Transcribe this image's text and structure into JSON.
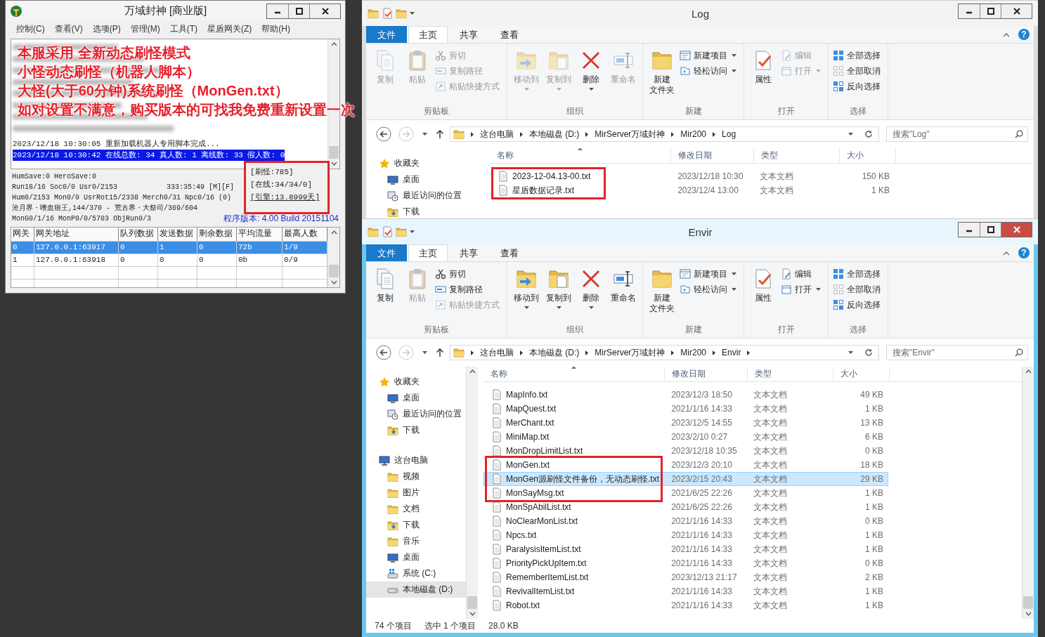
{
  "server_window": {
    "title": "万域封神 [商业版]",
    "menu": [
      "控制(C)",
      "查看(V)",
      "选项(P)",
      "管理(M)",
      "工具(T)",
      "星盾网关(Z)",
      "帮助(H)"
    ],
    "annotation_lines": [
      "本服采用 全新动态刷怪模式",
      "小怪动态刷怪（机器人脚本）",
      "大怪(大于60分钟)系统刷怪（MonGen.txt）",
      "如对设置不满意，购买版本的可找我免费重新设置一次"
    ],
    "log_lines": [
      {
        "text": "2023/12/18 10:30:05 重新加载机器人专用脚本完成...",
        "selected": false
      },
      {
        "text": "2023/12/18 10:30:42 在线总数: 34 真人数: 1 离线数: 33 假人数: 0",
        "selected": true
      }
    ],
    "status_lines": [
      {
        "text": "HumSave:0 HeroSave:0"
      },
      {
        "text": "Run18/16 Soc0/0 Usr0/2153",
        "aside": {
          "text": "333:35:49 [M][F]",
          "kind": "time"
        }
      },
      {
        "text": "Hum0/2153 Mon0/0 UsrRot15/2338 Merch0/31 Npc0/16 (0)"
      },
      {
        "text": "沧月界・嗜血狼王,144/370 - 荒古界・大祭司/369/604"
      },
      {
        "text": "MonG0/1/16 MonP0/0/5703 ObjRun0/3",
        "aside": {
          "text": "程序版本: 4.00 Build 20151104",
          "kind": "version"
        }
      }
    ],
    "stats_box": {
      "circled": true,
      "lines": [
        {
          "text": "[刷怪:785]",
          "underlined": false
        },
        {
          "text": "[在线:34/34/0]",
          "underlined": false
        },
        {
          "text": "[引擎:13.8999天]",
          "underlined": true
        }
      ]
    },
    "gateway_table": {
      "columns": [
        "网关",
        "网关地址",
        "队列数据",
        "发送数据",
        "剩余数据",
        "平均流量",
        "最高人数"
      ],
      "rows": [
        {
          "cells": [
            "0",
            "127.0.0.1:63917",
            "0",
            "1",
            "0",
            "72b",
            "1/9"
          ],
          "selected": true
        },
        {
          "cells": [
            "1",
            "127.0.0.1:63918",
            "0",
            "0",
            "0",
            "0b",
            "0/9"
          ],
          "selected": false
        }
      ]
    }
  },
  "explorers": [
    {
      "title": "Log",
      "active": false,
      "scrollbars": false,
      "help": "?",
      "tabs": [
        {
          "label": "文件",
          "kind": "file",
          "selected": false
        },
        {
          "label": "主页",
          "kind": "tab",
          "selected": true
        },
        {
          "label": "共享",
          "kind": "tab",
          "selected": false
        },
        {
          "label": "查看",
          "kind": "tab",
          "selected": false
        }
      ],
      "ribbon": [
        {
          "label": "剪贴板",
          "items": [
            {
              "label": "复制",
              "kind": "large",
              "disabled": true,
              "dropdown": false
            },
            {
              "label": "粘贴",
              "kind": "large",
              "disabled": true,
              "dropdown": false
            },
            {
              "label": "剪切",
              "kind": "small",
              "disabled": true,
              "dropdown": false
            },
            {
              "label": "复制路径",
              "kind": "small",
              "disabled": true,
              "dropdown": false
            },
            {
              "label": "粘贴快捷方式",
              "kind": "small",
              "disabled": true,
              "dropdown": false
            }
          ]
        },
        {
          "label": "组织",
          "items": [
            {
              "label": "移动到",
              "kind": "large",
              "disabled": true,
              "dropdown": true
            },
            {
              "label": "复制到",
              "kind": "large",
              "disabled": true,
              "dropdown": true
            },
            {
              "label": "删除",
              "kind": "large",
              "disabled": false,
              "dropdown": true
            },
            {
              "label": "重命名",
              "kind": "large",
              "disabled": true,
              "dropdown": false
            }
          ]
        },
        {
          "label": "新建",
          "items": [
            {
              "label_lines": [
                "新建",
                "文件夹"
              ],
              "kind": "large",
              "disabled": false,
              "dropdown": false
            },
            {
              "label": "新建项目",
              "kind": "small",
              "disabled": false,
              "dropdown": true
            },
            {
              "label": "轻松访问",
              "kind": "small",
              "disabled": false,
              "dropdown": true
            }
          ]
        },
        {
          "label": "打开",
          "items": [
            {
              "label": "属性",
              "kind": "large",
              "disabled": false,
              "dropdown": false
            },
            {
              "label": "编辑",
              "kind": "small",
              "disabled": true,
              "dropdown": false
            },
            {
              "label": "打开",
              "kind": "small",
              "disabled": true,
              "dropdown": true
            }
          ]
        },
        {
          "label": "选择",
          "items": [
            {
              "label": "全部选择",
              "kind": "small",
              "disabled": false,
              "dropdown": false
            },
            {
              "label": "全部取消",
              "kind": "small",
              "disabled": false,
              "dropdown": false
            },
            {
              "label": "反向选择",
              "kind": "small",
              "disabled": false,
              "dropdown": false
            }
          ]
        }
      ],
      "breadcrumb": [
        "这台电脑",
        "本地磁盘 (D:)",
        "MirServer万域封神",
        "Mir200",
        "Log"
      ],
      "breadcrumb_open_end": false,
      "search_placeholder": "搜索\"Log\"",
      "sidebar": [
        {
          "label": "收藏夹",
          "kind": "favorites",
          "selected": false,
          "children": [
            {
              "label": "桌面",
              "kind": "desktop",
              "selected": false
            },
            {
              "label": "最近访问的位置",
              "kind": "places",
              "selected": false
            },
            {
              "label": "下载",
              "kind": "downloads",
              "selected": false
            }
          ]
        }
      ],
      "columns": [
        {
          "label": "名称",
          "sorted": true
        },
        {
          "label": "修改日期",
          "sorted": false
        },
        {
          "label": "类型",
          "sorted": false
        },
        {
          "label": "大小",
          "sorted": false
        }
      ],
      "files": [
        {
          "name": "2023-12-04.13-00.txt",
          "date": "2023/12/18 10:30",
          "type": "文本文档",
          "size": "150 KB",
          "selected": false,
          "circled": true
        },
        {
          "name": "星盾数据记录.txt",
          "date": "2023/12/4 13:00",
          "type": "文本文档",
          "size": "1 KB",
          "selected": false,
          "circled": true
        }
      ]
    },
    {
      "title": "Envir",
      "active": true,
      "scrollbars": true,
      "help": "?",
      "tabs": [
        {
          "label": "文件",
          "kind": "file",
          "selected": false
        },
        {
          "label": "主页",
          "kind": "tab",
          "selected": true
        },
        {
          "label": "共享",
          "kind": "tab",
          "selected": false
        },
        {
          "label": "查看",
          "kind": "tab",
          "selected": false
        }
      ],
      "ribbon": [
        {
          "label": "剪贴板",
          "items": [
            {
              "label": "复制",
              "kind": "large",
              "disabled": false,
              "dropdown": false
            },
            {
              "label": "粘贴",
              "kind": "large",
              "disabled": true,
              "dropdown": false
            },
            {
              "label": "剪切",
              "kind": "small",
              "disabled": false,
              "dropdown": false
            },
            {
              "label": "复制路径",
              "kind": "small",
              "disabled": false,
              "dropdown": false
            },
            {
              "label": "粘贴快捷方式",
              "kind": "small",
              "disabled": true,
              "dropdown": false
            }
          ]
        },
        {
          "label": "组织",
          "items": [
            {
              "label": "移动到",
              "kind": "large",
              "disabled": false,
              "dropdown": true
            },
            {
              "label": "复制到",
              "kind": "large",
              "disabled": false,
              "dropdown": true
            },
            {
              "label": "删除",
              "kind": "large",
              "disabled": false,
              "dropdown": true
            },
            {
              "label": "重命名",
              "kind": "large",
              "disabled": false,
              "dropdown": false
            }
          ]
        },
        {
          "label": "新建",
          "items": [
            {
              "label_lines": [
                "新建",
                "文件夹"
              ],
              "kind": "large",
              "disabled": false,
              "dropdown": false
            },
            {
              "label": "新建项目",
              "kind": "small",
              "disabled": false,
              "dropdown": true
            },
            {
              "label": "轻松访问",
              "kind": "small",
              "disabled": false,
              "dropdown": true
            }
          ]
        },
        {
          "label": "打开",
          "items": [
            {
              "label": "属性",
              "kind": "large",
              "disabled": false,
              "dropdown": false
            },
            {
              "label": "编辑",
              "kind": "small",
              "disabled": false,
              "dropdown": false
            },
            {
              "label": "打开",
              "kind": "small",
              "disabled": false,
              "dropdown": true
            }
          ]
        },
        {
          "label": "选择",
          "items": [
            {
              "label": "全部选择",
              "kind": "small",
              "disabled": false,
              "dropdown": false
            },
            {
              "label": "全部取消",
              "kind": "small",
              "disabled": false,
              "dropdown": false
            },
            {
              "label": "反向选择",
              "kind": "small",
              "disabled": false,
              "dropdown": false
            }
          ]
        }
      ],
      "breadcrumb": [
        "这台电脑",
        "本地磁盘 (D:)",
        "MirServer万域封神",
        "Mir200",
        "Envir"
      ],
      "breadcrumb_open_end": true,
      "search_placeholder": "搜索\"Envir\"",
      "sidebar": [
        {
          "label": "收藏夹",
          "kind": "favorites",
          "selected": false,
          "children": [
            {
              "label": "桌面",
              "kind": "desktop",
              "selected": false
            },
            {
              "label": "最近访问的位置",
              "kind": "places",
              "selected": false
            },
            {
              "label": "下载",
              "kind": "downloads",
              "selected": false
            }
          ]
        },
        {
          "label": "这台电脑",
          "kind": "computer",
          "selected": false,
          "children": [
            {
              "label": "视频",
              "kind": "folder",
              "selected": false
            },
            {
              "label": "图片",
              "kind": "folder",
              "selected": false
            },
            {
              "label": "文档",
              "kind": "folder",
              "selected": false
            },
            {
              "label": "下载",
              "kind": "downloads",
              "selected": false
            },
            {
              "label": "音乐",
              "kind": "folder",
              "selected": false
            },
            {
              "label": "桌面",
              "kind": "desktop",
              "selected": false
            },
            {
              "label": "系统 (C:)",
              "kind": "system_drive",
              "selected": false
            },
            {
              "label": "本地磁盘 (D:)",
              "kind": "drive",
              "selected": true
            }
          ]
        }
      ],
      "columns": [
        {
          "label": "名称",
          "sorted": true
        },
        {
          "label": "修改日期",
          "sorted": false
        },
        {
          "label": "类型",
          "sorted": false
        },
        {
          "label": "大小",
          "sorted": false
        }
      ],
      "files": [
        {
          "name": "MapInfo.txt",
          "date": "2023/12/3 18:50",
          "type": "文本文档",
          "size": "49 KB",
          "selected": false,
          "circled": false
        },
        {
          "name": "MapQuest.txt",
          "date": "2021/1/16 14:33",
          "type": "文本文档",
          "size": "1 KB",
          "selected": false,
          "circled": false
        },
        {
          "name": "MerChant.txt",
          "date": "2023/12/5 14:55",
          "type": "文本文档",
          "size": "13 KB",
          "selected": false,
          "circled": false
        },
        {
          "name": "MiniMap.txt",
          "date": "2023/2/10 0:27",
          "type": "文本文档",
          "size": "6 KB",
          "selected": false,
          "circled": false
        },
        {
          "name": "MonDropLimitList.txt",
          "date": "2023/12/18 10:35",
          "type": "文本文档",
          "size": "0 KB",
          "selected": false,
          "circled": false
        },
        {
          "name": "MonGen.txt",
          "date": "2023/12/3 20:10",
          "type": "文本文档",
          "size": "18 KB",
          "selected": false,
          "circled": true
        },
        {
          "name": "MonGen源刷怪文件备份，无动态刷怪.txt",
          "date": "2023/2/15 20:43",
          "type": "文本文档",
          "size": "29 KB",
          "selected": true,
          "circled": true
        },
        {
          "name": "MonSayMsg.txt",
          "date": "2021/6/25 22:26",
          "type": "文本文档",
          "size": "1 KB",
          "selected": false,
          "circled": true
        },
        {
          "name": "MonSpAbilList.txt",
          "date": "2021/6/25 22:26",
          "type": "文本文档",
          "size": "1 KB",
          "selected": false,
          "circled": false
        },
        {
          "name": "NoClearMonList.txt",
          "date": "2021/1/16 14:33",
          "type": "文本文档",
          "size": "0 KB",
          "selected": false,
          "circled": false
        },
        {
          "name": "Npcs.txt",
          "date": "2021/1/16 14:33",
          "type": "文本文档",
          "size": "1 KB",
          "selected": false,
          "circled": false
        },
        {
          "name": "ParalysisItemList.txt",
          "date": "2021/1/16 14:33",
          "type": "文本文档",
          "size": "1 KB",
          "selected": false,
          "circled": false
        },
        {
          "name": "PriorityPickUpItem.txt",
          "date": "2021/1/16 14:33",
          "type": "文本文档",
          "size": "0 KB",
          "selected": false,
          "circled": false
        },
        {
          "name": "RememberItemList.txt",
          "date": "2023/12/13 21:17",
          "type": "文本文档",
          "size": "2 KB",
          "selected": false,
          "circled": false
        },
        {
          "name": "RevivalItemList.txt",
          "date": "2021/1/16 14:33",
          "type": "文本文档",
          "size": "1 KB",
          "selected": false,
          "circled": false
        },
        {
          "name": "Robot.txt",
          "date": "2021/1/16 14:33",
          "type": "文本文档",
          "size": "1 KB",
          "selected": false,
          "circled": false
        }
      ],
      "status_bar": [
        "74 个项目",
        "选中 1 个项目",
        "28.0 KB"
      ]
    }
  ]
}
